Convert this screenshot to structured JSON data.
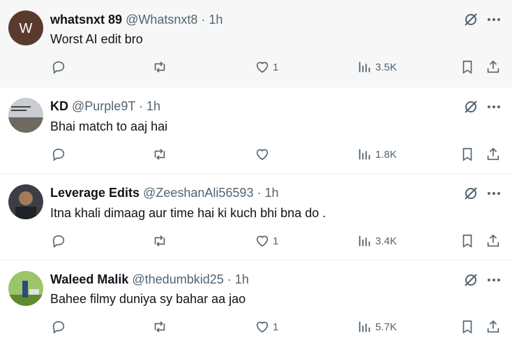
{
  "tweets": [
    {
      "avatar_letter": "W",
      "avatar_color": "#5b3a2e",
      "name": "whatsnxt 89",
      "handle": "@Whatsnxt8",
      "separator": "·",
      "time": "1h",
      "text": "Worst AI edit bro",
      "likes": "1",
      "views": "3.5K",
      "highlighted": true
    },
    {
      "avatar_letter": "",
      "avatar_color": "#8a8f93",
      "name": "KD",
      "handle": "@Purple9T",
      "separator": "·",
      "time": "1h",
      "text": "Bhai match to aaj hai",
      "likes": "",
      "views": "1.8K",
      "highlighted": false
    },
    {
      "avatar_letter": "",
      "avatar_color": "#3b3f44",
      "name": "Leverage Edits",
      "handle": "@ZeeshanAli56593",
      "separator": "·",
      "time": "1h",
      "text": "Itna khali dimaag aur time hai ki kuch bhi bna do .",
      "likes": "1",
      "views": "3.4K",
      "highlighted": false
    },
    {
      "avatar_letter": "",
      "avatar_color": "#7fae3a",
      "name": "Waleed Malik",
      "handle": "@thedumbkid25",
      "separator": "·",
      "time": "1h",
      "text": "Bahee filmy duniya sy bahar aa jao",
      "likes": "1",
      "views": "5.7K",
      "highlighted": false
    }
  ],
  "icons": {
    "reply": "reply-icon",
    "retweet": "retweet-icon",
    "like": "heart-icon",
    "views": "views-icon",
    "bookmark": "bookmark-icon",
    "share": "share-icon",
    "grok": "grok-icon",
    "more": "more-icon"
  },
  "colors": {
    "secondary_text": "#536471",
    "highlight_bg": "#f7f7f7"
  }
}
